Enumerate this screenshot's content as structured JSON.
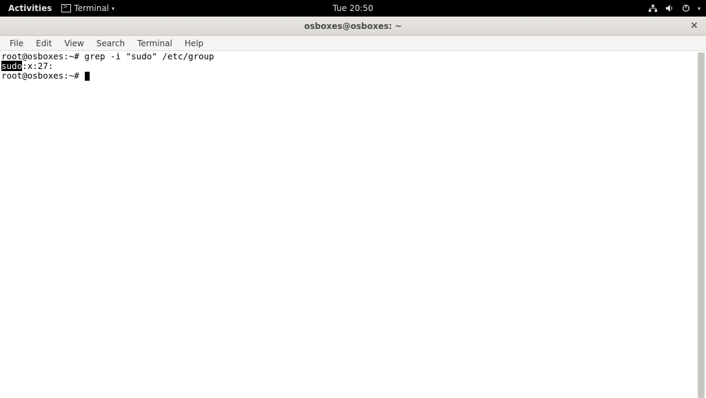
{
  "topbar": {
    "activities": "Activities",
    "app_name": "Terminal",
    "clock": "Tue 20:50"
  },
  "window": {
    "title": "osboxes@osboxes: ~"
  },
  "menubar": {
    "file": "File",
    "edit": "Edit",
    "view": "View",
    "search": "Search",
    "terminal": "Terminal",
    "help": "Help"
  },
  "terminal": {
    "line1_prompt": "root@osboxes:~# ",
    "line1_cmd": "grep -i \"sudo\" /etc/group",
    "line2_match": "sudo",
    "line2_rest": ":x:27:",
    "line3_prompt": "root@osboxes:~# "
  }
}
